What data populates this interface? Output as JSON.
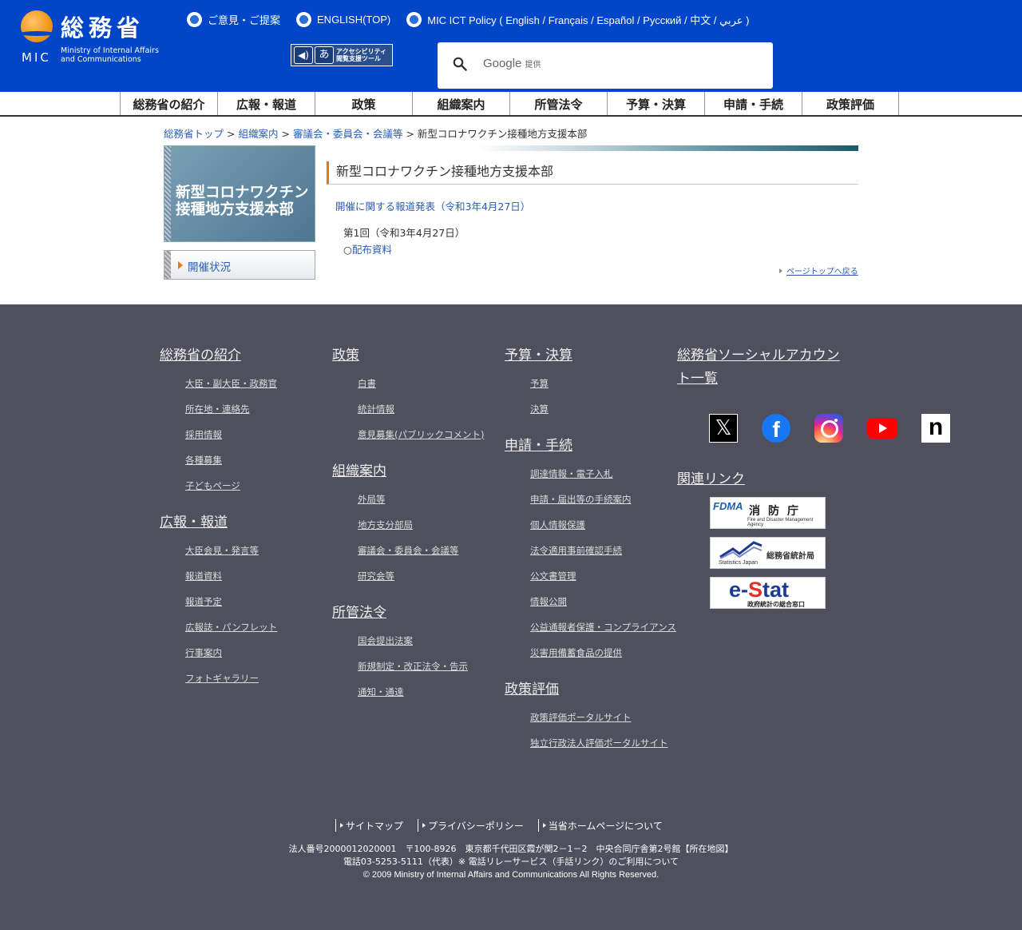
{
  "header": {
    "logo_kanji": "総務省",
    "logo_mic": "MIC",
    "logo_en_line1": "Ministry of Internal Affairs",
    "logo_en_line2": "and Communications",
    "toplinks": [
      {
        "label": "ご意見・ご提案"
      },
      {
        "label": "ENGLISH(TOP)"
      },
      {
        "label": "MIC ICT Policy ( English / Français / Español / Русский / 中文 / عربي )"
      }
    ],
    "access_tool": {
      "line1": "アクセシビリティ",
      "line2": "閲覧支援ツール"
    },
    "search": {
      "brand": "Google",
      "brand_suffix": "提供"
    }
  },
  "gnav": [
    "総務省の紹介",
    "広報・報道",
    "政策",
    "組織案内",
    "所管法令",
    "予算・決算",
    "申請・手続",
    "政策評価"
  ],
  "breadcrumb": {
    "items": [
      "総務省トップ",
      "組織案内",
      "審議会・委員会・会議等"
    ],
    "sep": ">",
    "current": "新型コロナワクチン接種地方支援本部"
  },
  "sidebar": {
    "title": "新型コロナワクチン接種地方支援本部",
    "item": "開催状況"
  },
  "content": {
    "title": "新型コロナワクチン接種地方支援本部",
    "press_link": "開催に関する報道発表（令和3年4月27日）",
    "meeting": "第1回（令和3年4月27日）",
    "material_prefix": "○",
    "material_link": "配布資料",
    "pagetop": "ページトップへ戻る"
  },
  "footer": {
    "col1": [
      {
        "head": "総務省の紹介",
        "links": [
          "大臣・副大臣・政務官",
          "所在地・連絡先",
          "採用情報",
          "各種募集",
          "子どもページ"
        ]
      },
      {
        "head": "広報・報道",
        "links": [
          "大臣会見・発言等",
          "報道資料",
          "報道予定",
          "広報誌・パンフレット",
          "行事案内",
          "フォトギャラリー"
        ]
      }
    ],
    "col2": [
      {
        "head": "政策",
        "links": [
          "白書",
          "統計情報",
          "意見募集(パブリックコメント)"
        ]
      },
      {
        "head": "組織案内",
        "links": [
          "外局等",
          "地方支分部局",
          "審議会・委員会・会議等",
          "研究会等"
        ]
      },
      {
        "head": "所管法令",
        "links": [
          "国会提出法案",
          "新規制定・改正法令・告示",
          "通知・通達"
        ]
      }
    ],
    "col3": [
      {
        "head": "予算・決算",
        "links": [
          "予算",
          "決算"
        ]
      },
      {
        "head": "申請・手続",
        "links": [
          "調達情報・電子入札",
          "申請・届出等の手続案内",
          "個人情報保護",
          "法令適用事前確認手続",
          "公文書管理",
          "情報公開",
          "公益通報者保護・コンプライアンス",
          "災害用備蓄食品の提供"
        ]
      },
      {
        "head": "政策評価",
        "links": [
          "政策評価ポータルサイト",
          "独立行政法人評価ポータルサイト"
        ]
      }
    ],
    "social_head_line1": "総務省ソーシャルアカウン",
    "social_head_line2": "ト一覧",
    "related_head": "関連リンク",
    "banners": {
      "fdma_logo": "FDMA",
      "fdma_name": "消防庁",
      "fdma_en": "Fire and Disaster Management Agency",
      "stat_name": "総務省統計局",
      "stat_en": "Statistics Japan",
      "estat_e": "e-",
      "estat_s": "S",
      "estat_rest": "tat",
      "estat_sub": "政府統計の総合窓口"
    },
    "bottom_links": [
      "サイトマップ",
      "プライバシーポリシー",
      "当省ホームページについて"
    ],
    "address": {
      "line1": "法人番号2000012020001　〒100-8926　東京都千代田区霞が関2－1－2　中央合同庁舎第2号館【",
      "map_link": "所在地図",
      "line1_end": "】",
      "line2": "電話03-5253-5111（代表）",
      "relay_link": "※ 電話リレーサービス（手話リンク）のご利用について",
      "copyright": "© 2009 Ministry of Internal Affairs and Communications All Rights Reserved."
    }
  },
  "colors": {
    "header_bg": "#0146c8",
    "footer_bg": "#4f4f5d",
    "accent": "#e27a1a",
    "link": "#2a5db0"
  }
}
